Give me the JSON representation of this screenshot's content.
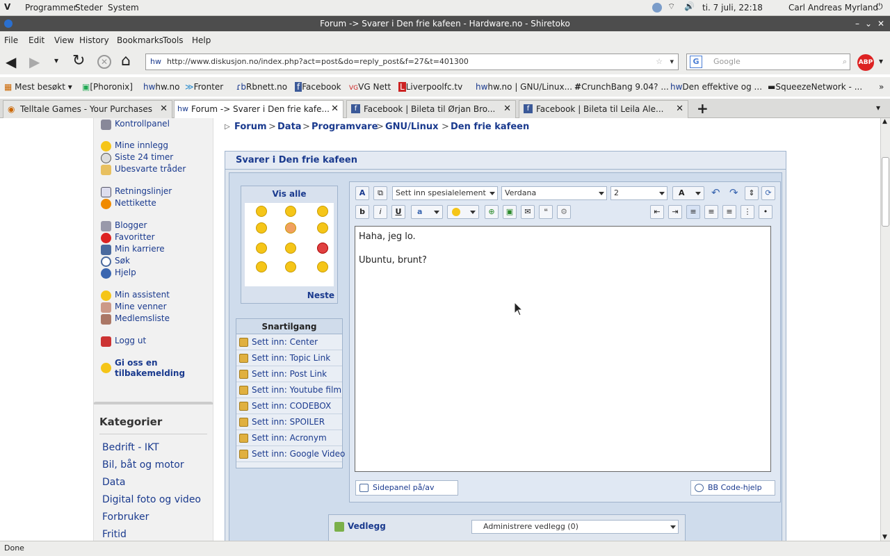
{
  "system_panel": {
    "menus": [
      "Programmer",
      "Steder",
      "System"
    ],
    "clock": "ti.  7 juli, 22:18",
    "user": "Carl Andreas Myrland"
  },
  "window": {
    "title": "Forum -> Svarer i Den frie kafeen - Hardware.no - Shiretoko"
  },
  "menubar": [
    "File",
    "Edit",
    "View",
    "History",
    "Bookmarks",
    "Tools",
    "Help"
  ],
  "navbar": {
    "url": "http://www.diskusjon.no/index.php?act=post&do=reply_post&f=27&t=401300",
    "search_placeholder": "Google"
  },
  "bookmarks": [
    "Mest besøkt",
    "[Phoronix]",
    "hw.no",
    "Fronter",
    "Rbnett.no",
    "Facebook",
    "VG Nett",
    "Liverpoolfc.tv",
    "hw.no | GNU/Linux...",
    "CrunchBang 9.04? ...",
    "Den effektive og ...",
    "SqueezeNetwork - ..."
  ],
  "tabs": [
    {
      "label": "Telltale Games - Your Purchases",
      "active": false
    },
    {
      "label": "Forum -> Svarer i Den frie kafe...",
      "active": true
    },
    {
      "label": "Facebook | Bileta til Ørjan Bro...",
      "active": false
    },
    {
      "label": "Facebook | Bileta til Leila Ale...",
      "active": false
    }
  ],
  "sidebar": {
    "items": [
      {
        "label": "Kontrollpanel",
        "icon": "tools-icon"
      },
      {
        "label": "Mine innlegg",
        "icon": "smiley-icon"
      },
      {
        "label": "Siste 24 timer",
        "icon": "clock-icon"
      },
      {
        "label": "Ubesvarte tråder",
        "icon": "envelope-icon"
      },
      {
        "label": "Retningslinjer",
        "icon": "document-icon"
      },
      {
        "label": "Nettikette",
        "icon": "warning-icon"
      },
      {
        "label": "Blogger",
        "icon": "blog-icon"
      },
      {
        "label": "Favoritter",
        "icon": "heart-icon"
      },
      {
        "label": "Min karriere",
        "icon": "footprints-icon"
      },
      {
        "label": "Søk",
        "icon": "magnifier-icon"
      },
      {
        "label": "Hjelp",
        "icon": "help-icon"
      },
      {
        "label": "Min assistent",
        "icon": "assistant-icon"
      },
      {
        "label": "Mine venner",
        "icon": "friends-icon"
      },
      {
        "label": "Medlemsliste",
        "icon": "members-icon"
      },
      {
        "label": "Logg ut",
        "icon": "logout-icon"
      },
      {
        "label": "Gi oss en tilbakemelding",
        "icon": "feedback-icon"
      }
    ]
  },
  "categories": {
    "title": "Kategorier",
    "items": [
      "Bedrift - IKT",
      "Bil, båt og motor",
      "Data",
      "Digital foto og video",
      "Forbruker",
      "Fritid"
    ]
  },
  "breadcrumb": [
    "Forum",
    "Data",
    "Programvare",
    "GNU/Linux",
    "Den frie kafeen"
  ],
  "reply_box": {
    "title": "Svarer i Den frie kafeen",
    "emoticons": {
      "show_all": "Vis alle",
      "next": "Neste"
    },
    "quick_access": {
      "title": "Snartilgang",
      "items": [
        "Sett inn: Center",
        "Sett inn: Topic Link",
        "Sett inn: Post Link",
        "Sett inn: Youtube film",
        "Sett inn: CODEBOX",
        "Sett inn: SPOILER",
        "Sett inn: Acronym",
        "Sett inn: Google Video"
      ]
    },
    "toolbar": {
      "special_element": "Sett inn spesialelement",
      "font": "Verdana",
      "size": "2"
    },
    "message_lines": [
      "Haha, jeg lo.",
      "Ubuntu, brunt?"
    ],
    "sidepanel_toggle": "Sidepanel på/av",
    "bbcode_help": "BB Code-hjelp",
    "attachments": {
      "title": "Vedlegg",
      "select": "Administrere vedlegg (0)"
    }
  },
  "status": "Done"
}
